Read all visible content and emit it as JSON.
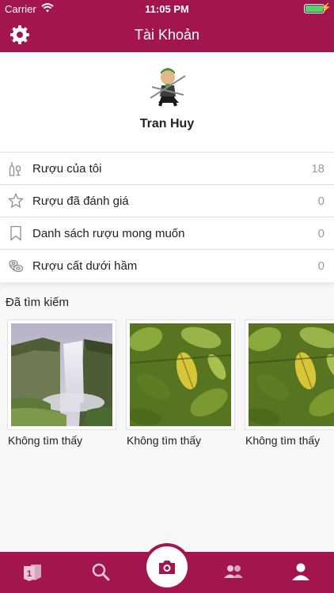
{
  "status_bar": {
    "carrier": "Carrier",
    "time": "11:05 PM",
    "battery_level": 1.0
  },
  "header": {
    "title": "Tài Khoản"
  },
  "profile": {
    "name": "Tran Huy"
  },
  "menu": [
    {
      "label": "Rượu của tôi",
      "count": "18",
      "icon": "wine-bottles-icon"
    },
    {
      "label": "Rượu đã đánh giá",
      "count": "0",
      "icon": "star-icon"
    },
    {
      "label": "Danh sách rượu mong muốn",
      "count": "0",
      "icon": "bookmark-icon"
    },
    {
      "label": "Rượu cất dưới hầm",
      "count": "0",
      "icon": "wine-barrel-icon"
    }
  ],
  "history": {
    "title": "Đã tìm kiếm",
    "items": [
      {
        "caption": "Không tìm thấy",
        "image": "waterfall-photo"
      },
      {
        "caption": "Không tìm thấy",
        "image": "leaves-photo"
      },
      {
        "caption": "Không tìm thấy",
        "image": "leaves-photo"
      }
    ]
  },
  "tab_bar": {
    "tabs": [
      {
        "icon": "badge-card-icon",
        "badge": "1"
      },
      {
        "icon": "search-icon"
      },
      {
        "icon": "camera-icon"
      },
      {
        "icon": "users-icon"
      },
      {
        "icon": "profile-icon"
      }
    ]
  },
  "colors": {
    "brand": "#a3154f",
    "battery": "#4cd964"
  }
}
